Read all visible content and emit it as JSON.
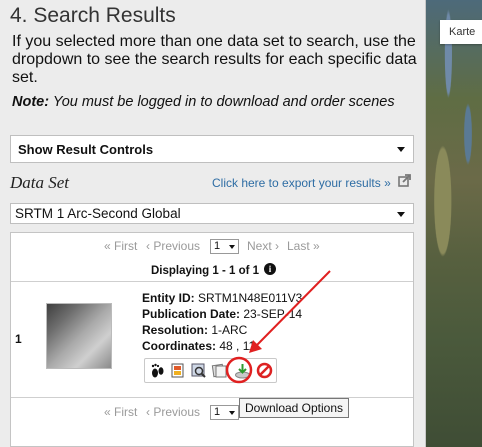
{
  "section": {
    "title": "4. Search Results",
    "description": "If you selected more than one data set to search, use the dropdown to see the search results for each specific data set.",
    "note_label": "Note:",
    "note_text": " You must be logged in to download and order scenes"
  },
  "result_controls": {
    "label": "Show Result Controls"
  },
  "dataset": {
    "label": "Data Set",
    "export_link": "Click here to export your results »",
    "selected": "SRTM 1 Arc-Second Global"
  },
  "pager": {
    "first": "« First",
    "previous": "‹ Previous",
    "page": "1",
    "next": "Next ›",
    "last": "Last »",
    "displaying_prefix": "Displaying ",
    "displaying_range": "1 - 1 of 1"
  },
  "result": {
    "number": "1",
    "entity_id_label": "Entity ID:",
    "entity_id": "SRTM1N48E011V3",
    "publication_date_label": "Publication Date:",
    "publication_date": "23-SEP-14",
    "resolution_label": "Resolution:",
    "resolution": "1-ARC",
    "coordinates_label": "Coordinates:",
    "coordinates": "48 , 11"
  },
  "action_icons": [
    "footprint-icon",
    "metadata-icon",
    "browse-overlay-icon",
    "compare-icon",
    "download-icon",
    "exclude-icon"
  ],
  "tooltip": "Download Options",
  "map": {
    "type_button": "Karte"
  },
  "colors": {
    "annotation": "#e02020",
    "link": "#2e6da4",
    "panel": "#ececec"
  }
}
